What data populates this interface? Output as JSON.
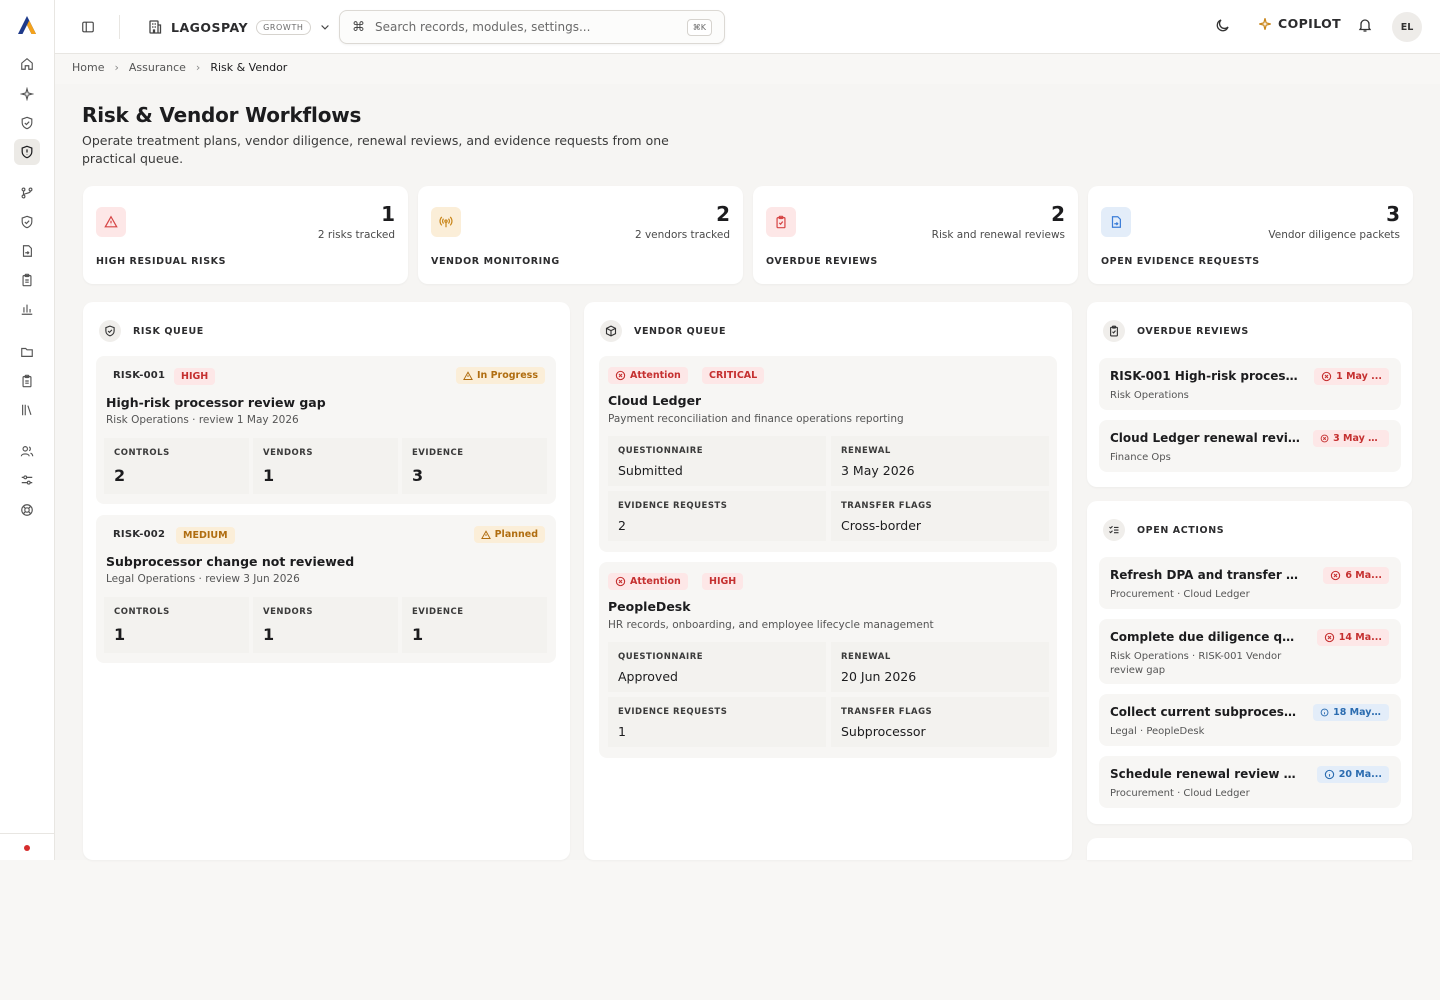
{
  "app": {
    "org_name": "LAGOSPAY",
    "org_plan": "GROWTH",
    "user_initials": "EL",
    "copilot_label": "COPILOT"
  },
  "search": {
    "placeholder": "Search records, modules, settings...",
    "shortcut": "⌘K"
  },
  "breadcrumb": [
    "Home",
    "Assurance",
    "Risk & Vendor"
  ],
  "page": {
    "title": "Risk & Vendor Workflows",
    "subtitle": "Operate treatment plans, vendor diligence, renewal reviews, and evidence requests from one practical queue."
  },
  "stats": [
    {
      "label": "HIGH RESIDUAL RISKS",
      "value": "1",
      "sub": "2 risks tracked",
      "icon": "warning-icon",
      "color": "#d64545"
    },
    {
      "label": "VENDOR MONITORING",
      "value": "2",
      "sub": "2 vendors tracked",
      "icon": "broadcast-icon",
      "color": "#c9861a"
    },
    {
      "label": "OVERDUE REVIEWS",
      "value": "2",
      "sub": "Risk and renewal reviews",
      "icon": "clipboard-icon",
      "color": "#d64545"
    },
    {
      "label": "OPEN EVIDENCE REQUESTS",
      "value": "3",
      "sub": "Vendor diligence packets",
      "icon": "file-icon",
      "color": "#3b7dd8"
    }
  ],
  "risk_queue": {
    "title": "RISK QUEUE",
    "items": [
      {
        "id": "RISK-001",
        "severity": "HIGH",
        "status": "In Progress",
        "title": "High-risk processor review gap",
        "meta": "Risk Operations · review 1 May 2026",
        "metrics": [
          {
            "label": "CONTROLS",
            "value": "2"
          },
          {
            "label": "VENDORS",
            "value": "1"
          },
          {
            "label": "EVIDENCE",
            "value": "3"
          }
        ]
      },
      {
        "id": "RISK-002",
        "severity": "MEDIUM",
        "status": "Planned",
        "title": "Subprocessor change not reviewed",
        "meta": "Legal Operations · review 3 Jun 2026",
        "metrics": [
          {
            "label": "CONTROLS",
            "value": "1"
          },
          {
            "label": "VENDORS",
            "value": "1"
          },
          {
            "label": "EVIDENCE",
            "value": "1"
          }
        ]
      }
    ]
  },
  "vendor_queue": {
    "title": "VENDOR QUEUE",
    "items": [
      {
        "status": "Attention",
        "tier": "CRITICAL",
        "name": "Cloud Ledger",
        "desc": "Payment reconciliation and finance operations reporting",
        "fields": [
          {
            "label": "QUESTIONNAIRE",
            "value": "Submitted"
          },
          {
            "label": "RENEWAL",
            "value": "3 May 2026"
          },
          {
            "label": "EVIDENCE REQUESTS",
            "value": "2"
          },
          {
            "label": "TRANSFER FLAGS",
            "value": "Cross-border"
          }
        ]
      },
      {
        "status": "Attention",
        "tier": "HIGH",
        "name": "PeopleDesk",
        "desc": "HR records, onboarding, and employee lifecycle management",
        "fields": [
          {
            "label": "QUESTIONNAIRE",
            "value": "Approved"
          },
          {
            "label": "RENEWAL",
            "value": "20 Jun 2026"
          },
          {
            "label": "EVIDENCE REQUESTS",
            "value": "1"
          },
          {
            "label": "TRANSFER FLAGS",
            "value": "Subprocessor"
          }
        ]
      }
    ]
  },
  "overdue_reviews": {
    "title": "OVERDUE REVIEWS",
    "items": [
      {
        "title": "RISK-001 High-risk processor r...",
        "sub": "Risk Operations",
        "due": "1 May ...",
        "tone": "red"
      },
      {
        "title": "Cloud Ledger renewal revie...",
        "sub": "Finance Ops",
        "due": "3 May 20...",
        "tone": "red"
      }
    ]
  },
  "open_actions": {
    "title": "OPEN ACTIONS",
    "items": [
      {
        "title": "Refresh DPA and transfer mec...",
        "sub": "Procurement · Cloud Ledger",
        "due": "6 Ma...",
        "tone": "red"
      },
      {
        "title": "Complete due diligence quest...",
        "sub": "Risk Operations · RISK-001 Vendor review gap",
        "due": "14 Ma...",
        "tone": "red"
      },
      {
        "title": "Collect current subprocess...",
        "sub": "Legal · PeopleDesk",
        "due": "18 May 2...",
        "tone": "blue"
      },
      {
        "title": "Schedule renewal review with...",
        "sub": "Procurement · Cloud Ledger",
        "due": "20 Ma...",
        "tone": "blue"
      }
    ]
  },
  "colors": {
    "accent_red": "#c53030",
    "accent_amber": "#b06d10",
    "accent_blue": "#2b6cb0",
    "brand": "#1e3a8a"
  }
}
